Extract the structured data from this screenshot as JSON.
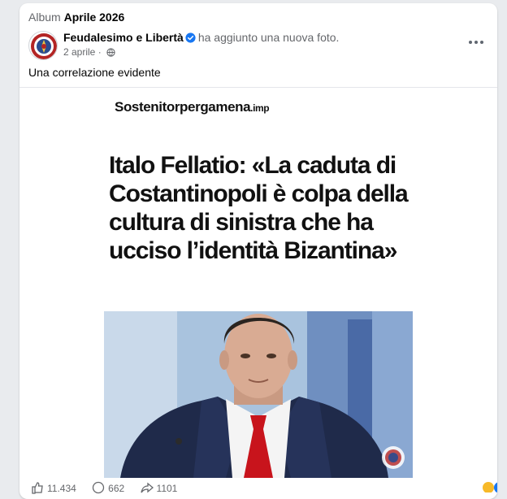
{
  "album": {
    "prefix": "Album",
    "name": "Aprile 2026"
  },
  "post": {
    "author": "Feudalesimo e Libertà",
    "action": "ha aggiunto una nuova foto.",
    "date": "2 aprile",
    "date_separator": "·",
    "caption": "Una correlazione evidente"
  },
  "image": {
    "site_name": "Sostenitorpergamena",
    "site_tld": ".imp",
    "headline_lines": [
      "Italo Fellatio: «La caduta di",
      "Costantinopoli è colpa della",
      "cultura di sinistra che ha",
      "ucciso l’identità Bizantina»"
    ]
  },
  "stats": {
    "likes": "11.434",
    "comments": "662",
    "shares": "1101"
  },
  "icons": {
    "verified": "verified-badge-icon",
    "audience": "globe-icon",
    "more": "more-options-icon",
    "like": "thumbs-up-icon",
    "comment": "comment-icon",
    "share": "share-icon"
  },
  "colors": {
    "page_bg": "#e9ebee",
    "card_bg": "#ffffff",
    "muted_text": "#65676b",
    "verified_blue": "#1877f2"
  }
}
